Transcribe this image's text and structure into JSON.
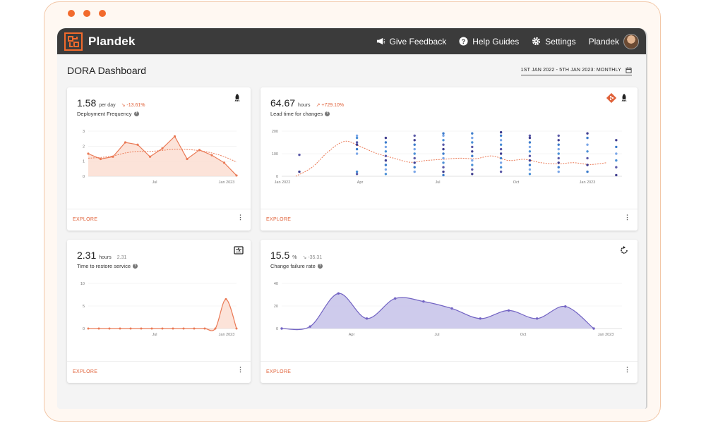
{
  "app": {
    "brand": "Plandek",
    "page_title": "DORA Dashboard",
    "date_range": "1ST JAN 2022 - 5TH JAN 2023: MONTHLY",
    "accent": "#f26a2c",
    "topbar_bg": "#3b3b3b"
  },
  "nav": [
    {
      "label": "Give Feedback",
      "icon": "megaphone-icon"
    },
    {
      "label": "Help Guides",
      "icon": "help-icon"
    },
    {
      "label": "Settings",
      "icon": "gear-icon"
    },
    {
      "label": "Plandek",
      "icon": "avatar"
    }
  ],
  "cards": {
    "deploy": {
      "value": "1.58",
      "unit": "per day",
      "trend": "-13.61%",
      "label": "Deployment Frequency",
      "icon": "rocket-icon",
      "explore": "EXPLORE"
    },
    "lead": {
      "value": "64.67",
      "unit": "hours",
      "trend": "+729.10%",
      "label": "Lead time for changes",
      "icons": [
        "git-icon",
        "rocket-icon"
      ],
      "explore": "EXPLORE"
    },
    "restore": {
      "value": "2.31",
      "unit": "hours",
      "trend": "2.31",
      "label": "Time to restore service",
      "icon": "incident-icon",
      "explore": "EXPLORE"
    },
    "failure": {
      "value": "15.5",
      "unit": "%",
      "trend": "-35.31",
      "label": "Change failure rate",
      "icon": "refresh-icon",
      "explore": "EXPLORE"
    }
  },
  "chart_data": [
    {
      "type": "area",
      "x_ticks": [
        "Jul",
        "Jan 2023"
      ],
      "y_ticks": [
        "0",
        "1",
        "2",
        "3"
      ],
      "ylim": [
        0,
        3
      ],
      "series": [
        {
          "values": [
            1.5,
            1.15,
            1.3,
            2.25,
            2.1,
            1.3,
            1.85,
            2.65,
            1.15,
            1.75,
            1.4,
            0.9,
            0.05
          ]
        },
        {
          "values": [
            1.2,
            1.25,
            1.35,
            1.55,
            1.65,
            1.65,
            1.72,
            1.8,
            1.78,
            1.7,
            1.55,
            1.3,
            0.95
          ]
        }
      ]
    },
    {
      "type": "scatter",
      "x_ticks": [
        "Jan 2022",
        "Apr",
        "Jul",
        "Oct",
        "Jan 2023"
      ],
      "y_ticks": [
        "0",
        "100",
        "200"
      ],
      "ylim": [
        0,
        200
      ],
      "trend": [
        0,
        40,
        110,
        155,
        130,
        100,
        80,
        62,
        70,
        75,
        80,
        78,
        90,
        70,
        75,
        60,
        55,
        60,
        52,
        60
      ],
      "columns": [
        {
          "x": 0.14,
          "values": [
            20,
            95
          ]
        },
        {
          "x": 0.34,
          "values": [
            10,
            20,
            100,
            120,
            140,
            150,
            170,
            180
          ]
        },
        {
          "x": 0.44,
          "values": [
            10,
            30,
            50,
            70,
            90,
            110,
            130,
            150,
            170
          ]
        },
        {
          "x": 0.54,
          "values": [
            20,
            40,
            60,
            80,
            100,
            120,
            140,
            160,
            180
          ]
        },
        {
          "x": 0.64,
          "values": [
            5,
            20,
            40,
            60,
            80,
            100,
            120,
            140,
            160,
            180,
            190
          ]
        },
        {
          "x": 0.74,
          "values": [
            10,
            30,
            50,
            70,
            90,
            110,
            130,
            150,
            170,
            190
          ]
        },
        {
          "x": 0.84,
          "values": [
            20,
            40,
            60,
            80,
            100,
            120,
            140,
            160,
            180,
            195
          ]
        },
        {
          "x": 0.94,
          "values": [
            10,
            30,
            50,
            70,
            90,
            110,
            130,
            150,
            170,
            180
          ]
        },
        {
          "x": 1.04,
          "values": [
            20,
            40,
            60,
            80,
            100,
            120,
            140,
            160,
            180
          ]
        },
        {
          "x": 1.14,
          "values": [
            20,
            50,
            80,
            110,
            140,
            170,
            190
          ]
        },
        {
          "x": 1.24,
          "values": [
            5,
            40,
            70,
            100,
            130,
            160
          ]
        }
      ]
    },
    {
      "type": "area",
      "x_ticks": [
        "Jul",
        "Jan 2023"
      ],
      "y_ticks": [
        "0",
        "5",
        "10"
      ],
      "ylim": [
        0,
        10
      ],
      "values": [
        0,
        0,
        0,
        0,
        0,
        0,
        0,
        0,
        0,
        0,
        0,
        0,
        0,
        6.5,
        0
      ]
    },
    {
      "type": "area",
      "x_ticks": [
        "Apr",
        "Jul",
        "Oct",
        "Jan 2023"
      ],
      "y_ticks": [
        "0",
        "20",
        "40"
      ],
      "ylim": [
        0,
        40
      ],
      "values": [
        0,
        2,
        35,
        10,
        30,
        27,
        20,
        10,
        18,
        10,
        22,
        0
      ]
    }
  ]
}
